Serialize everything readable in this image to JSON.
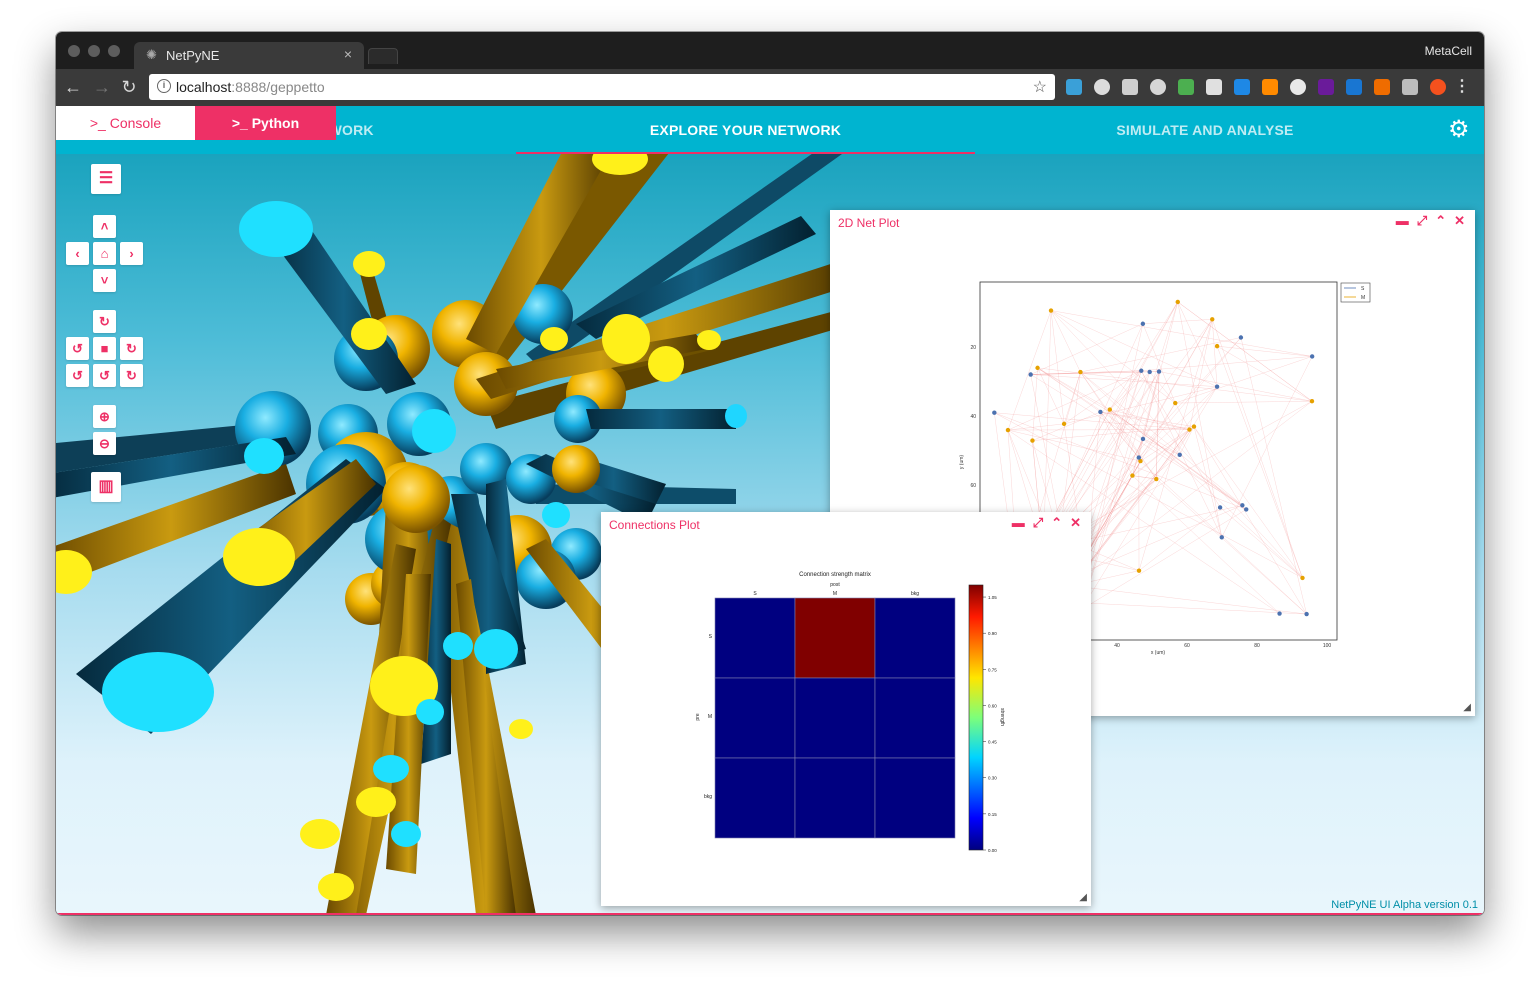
{
  "browser": {
    "tab_title": "NetPyNE",
    "tab_close": "×",
    "profile_name": "MetaCell",
    "url_host": "localhost",
    "url_rest": ":8888/geppetto"
  },
  "nav": {
    "tabs": [
      {
        "label": "DEFINE YOUR NETWORK"
      },
      {
        "label": "EXPLORE YOUR NETWORK"
      },
      {
        "label": "SIMULATE AND ANALYSE"
      }
    ],
    "active_index": 1
  },
  "panels": {
    "net_plot": {
      "title": "2D Net Plot",
      "xlabel": "x (um)",
      "ylabel": "y (um)",
      "xticks": [
        "40",
        "60",
        "80",
        "100"
      ],
      "yticks": [
        "20",
        "40",
        "60"
      ],
      "legend": [
        {
          "name": "S",
          "color": "#4c72b0"
        },
        {
          "name": "M",
          "color": "#e6a100"
        }
      ]
    },
    "connections_plot": {
      "title": "Connections Plot",
      "chart_title": "Connection strength matrix",
      "col_axis_label": "post",
      "row_axis_label": "pre",
      "columns": [
        "S",
        "M",
        "bkg"
      ],
      "rows": [
        "S",
        "M",
        "bkg"
      ],
      "colorbar_label": "strength",
      "colorbar_ticks": [
        "1.05",
        "0.90",
        "0.75",
        "0.60",
        "0.45",
        "0.30",
        "0.15",
        "0.00"
      ]
    }
  },
  "chart_data": [
    {
      "type": "heatmap",
      "title": "Connection strength matrix",
      "xlabel": "post",
      "ylabel": "pre",
      "x": [
        "S",
        "M",
        "bkg"
      ],
      "y": [
        "S",
        "M",
        "bkg"
      ],
      "values": [
        [
          0,
          1.1,
          0
        ],
        [
          0,
          0,
          0
        ],
        [
          0,
          0,
          0
        ]
      ],
      "colorbar_range": [
        0,
        1.1
      ],
      "colormap": "jet"
    }
  ],
  "bottom": {
    "console_label": "Console",
    "python_label": "Python",
    "prompt_glyph": ">_",
    "version": "NetPyNE UI Alpha version 0.1"
  },
  "colors": {
    "accent": "#ee3066",
    "nav_bg": "#00b4d0",
    "axon_blue": "#0e4a66",
    "axon_gold": "#c79000",
    "soma_blue": "#1ec8f5",
    "soma_yellow": "#ffef00"
  }
}
